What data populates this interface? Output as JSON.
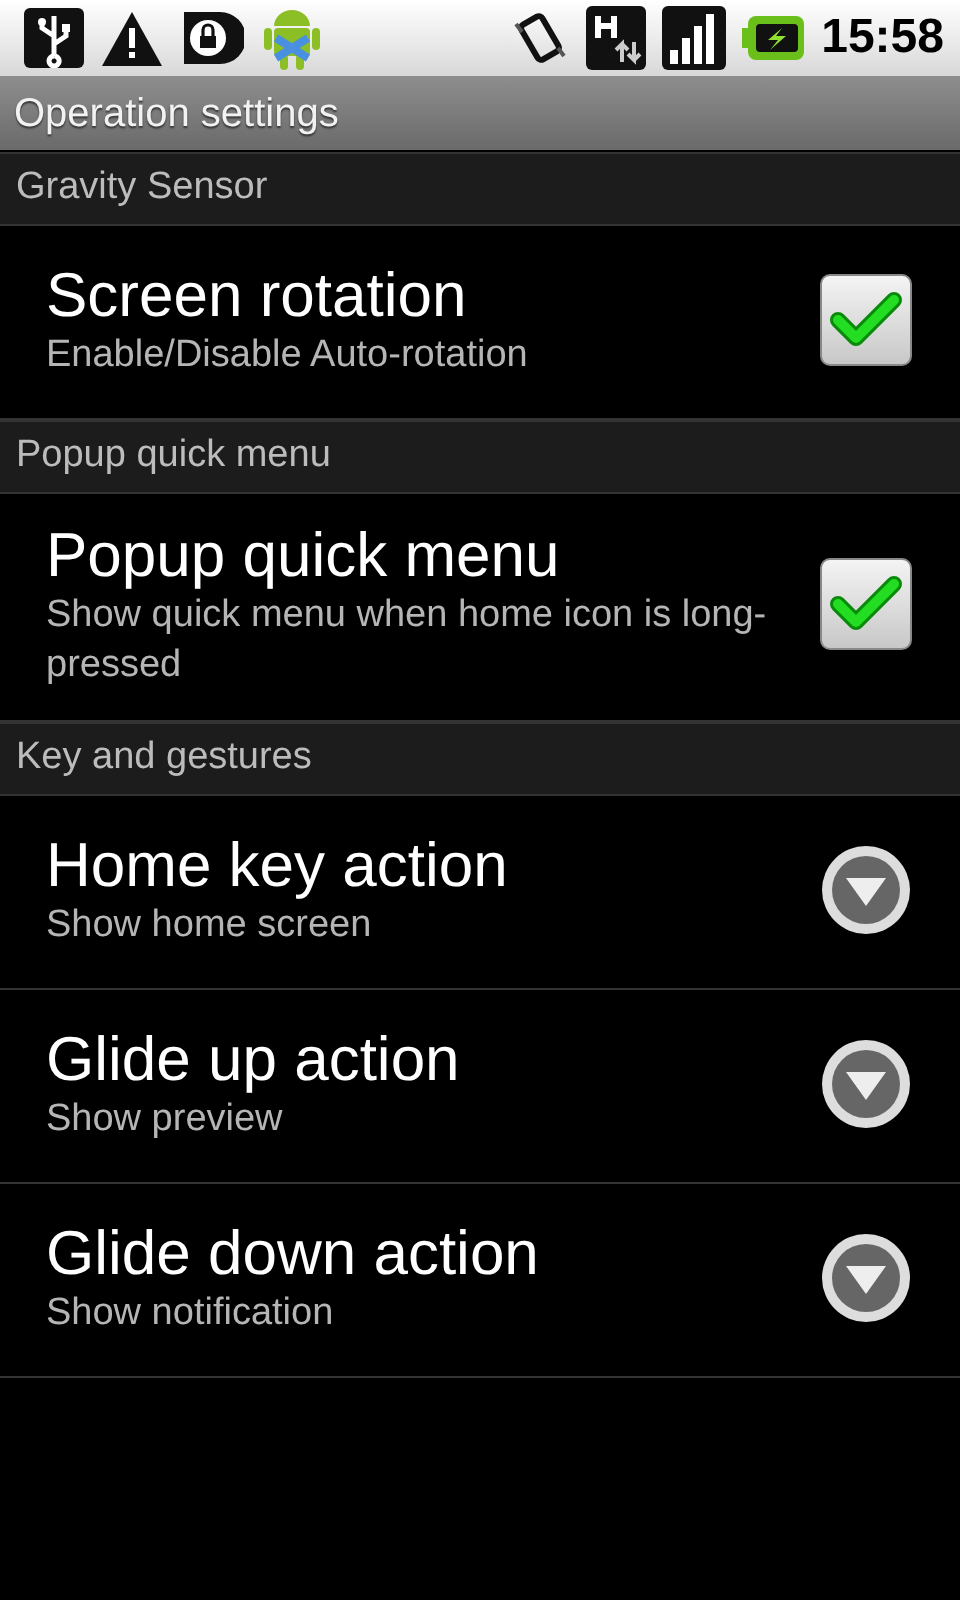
{
  "status_bar": {
    "time": "15:58"
  },
  "title": "Operation settings",
  "sections": [
    {
      "header": "Gravity Sensor",
      "items": [
        {
          "kind": "checkbox",
          "title": "Screen rotation",
          "summary": "Enable/Disable Auto-rotation",
          "checked": true
        }
      ]
    },
    {
      "header": "Popup quick menu",
      "items": [
        {
          "kind": "checkbox",
          "title": "Popup quick menu",
          "summary": "Show quick menu when home icon is long-pressed",
          "checked": true
        }
      ]
    },
    {
      "header": "Key and gestures",
      "items": [
        {
          "kind": "list",
          "title": "Home key action",
          "summary": "Show home screen"
        },
        {
          "kind": "list",
          "title": "Glide up action",
          "summary": "Show preview"
        },
        {
          "kind": "list",
          "title": "Glide down action",
          "summary": "Show notification"
        }
      ]
    }
  ]
}
